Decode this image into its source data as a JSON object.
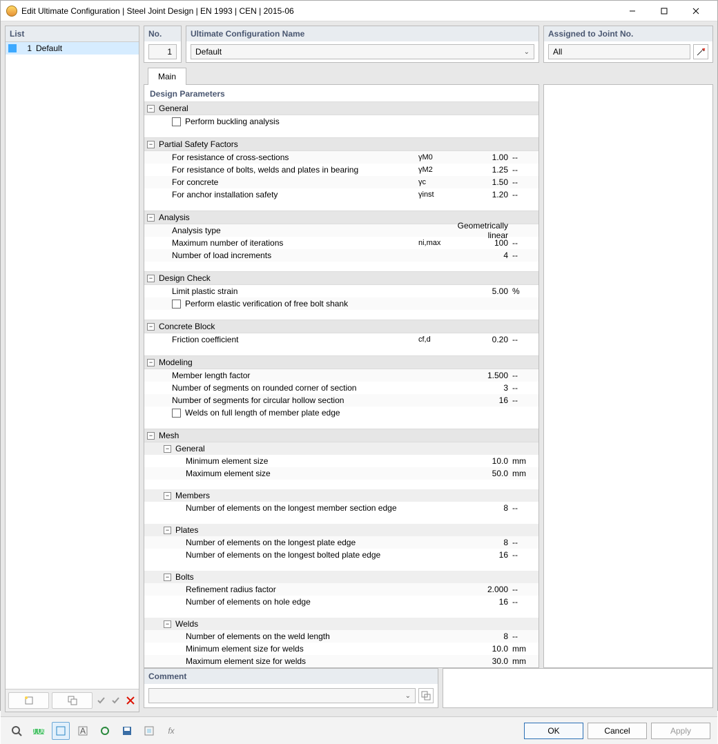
{
  "title": "Edit Ultimate Configuration | Steel Joint Design | EN 1993 | CEN | 2015-06",
  "left": {
    "header": "List",
    "item_no": "1",
    "item_label": "Default"
  },
  "hdr": {
    "no_label": "No.",
    "no_value": "1",
    "name_label": "Ultimate Configuration Name",
    "name_value": "Default",
    "assigned_label": "Assigned to Joint No.",
    "assigned_value": "All"
  },
  "tab_main": "Main",
  "params_title": "Design Parameters",
  "groups": {
    "general": "General",
    "perform_buckling": "Perform buckling analysis",
    "psf": "Partial Safety Factors",
    "psf_rows": [
      {
        "label": "For resistance of cross-sections",
        "sym": "γM0",
        "val": "1.00",
        "unit": "--"
      },
      {
        "label": "For resistance of bolts, welds and plates in bearing",
        "sym": "γM2",
        "val": "1.25",
        "unit": "--"
      },
      {
        "label": "For concrete",
        "sym": "γc",
        "val": "1.50",
        "unit": "--"
      },
      {
        "label": "For anchor installation safety",
        "sym": "γinst",
        "val": "1.20",
        "unit": "--"
      }
    ],
    "analysis": "Analysis",
    "analysis_rows": [
      {
        "label": "Analysis type",
        "sym": "",
        "val": "Geometrically linear",
        "unit": ""
      },
      {
        "label": "Maximum number of iterations",
        "sym": "ni,max",
        "val": "100",
        "unit": "--"
      },
      {
        "label": "Number of load increments",
        "sym": "",
        "val": "4",
        "unit": "--"
      }
    ],
    "design_check": "Design Check",
    "dc_rows": [
      {
        "label": "Limit plastic strain",
        "sym": "",
        "val": "5.00",
        "unit": "%"
      }
    ],
    "dc_chk": "Perform elastic verification of free bolt shank",
    "concrete": "Concrete Block",
    "concrete_rows": [
      {
        "label": "Friction coefficient",
        "sym": "cf,d",
        "val": "0.20",
        "unit": "--"
      }
    ],
    "modeling": "Modeling",
    "modeling_rows": [
      {
        "label": "Member length factor",
        "sym": "",
        "val": "1.500",
        "unit": "--"
      },
      {
        "label": "Number of segments on rounded corner of section",
        "sym": "",
        "val": "3",
        "unit": "--"
      },
      {
        "label": "Number of segments for circular hollow section",
        "sym": "",
        "val": "16",
        "unit": "--"
      }
    ],
    "modeling_chk": "Welds on full length of member plate edge",
    "mesh": "Mesh",
    "mesh_general": "General",
    "mesh_general_rows": [
      {
        "label": "Minimum element size",
        "sym": "",
        "val": "10.0",
        "unit": "mm"
      },
      {
        "label": "Maximum element size",
        "sym": "",
        "val": "50.0",
        "unit": "mm"
      }
    ],
    "mesh_members": "Members",
    "mesh_members_rows": [
      {
        "label": "Number of elements on the longest member section edge",
        "sym": "",
        "val": "8",
        "unit": "--"
      }
    ],
    "mesh_plates": "Plates",
    "mesh_plates_rows": [
      {
        "label": "Number of elements on the longest plate edge",
        "sym": "",
        "val": "8",
        "unit": "--"
      },
      {
        "label": "Number of elements on the longest bolted plate edge",
        "sym": "",
        "val": "16",
        "unit": "--"
      }
    ],
    "mesh_bolts": "Bolts",
    "mesh_bolts_rows": [
      {
        "label": "Refinement radius factor",
        "sym": "",
        "val": "2.000",
        "unit": "--"
      },
      {
        "label": "Number of elements on hole edge",
        "sym": "",
        "val": "16",
        "unit": "--"
      }
    ],
    "mesh_welds": "Welds",
    "mesh_welds_rows": [
      {
        "label": "Number of elements on the weld length",
        "sym": "",
        "val": "8",
        "unit": "--"
      },
      {
        "label": "Minimum element size for welds",
        "sym": "",
        "val": "10.0",
        "unit": "mm"
      },
      {
        "label": "Maximum element size for welds",
        "sym": "",
        "val": "30.0",
        "unit": "mm"
      }
    ]
  },
  "comment_label": "Comment",
  "buttons": {
    "ok": "OK",
    "cancel": "Cancel",
    "apply": "Apply"
  }
}
